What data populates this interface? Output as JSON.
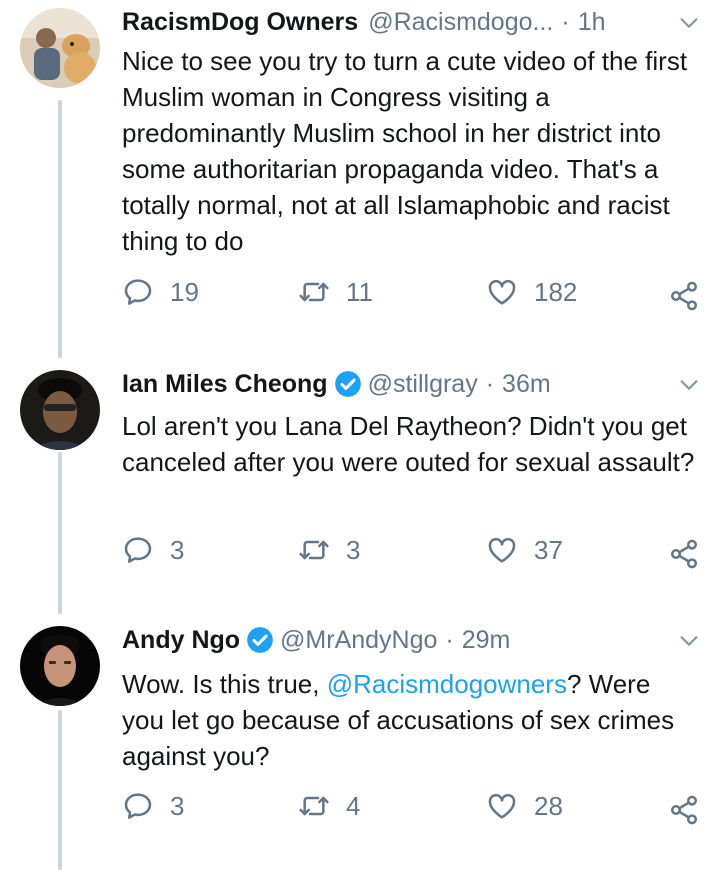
{
  "tweets": [
    {
      "name": "RacismDog Owners",
      "handle": "@Racismdogo...",
      "separator": "·",
      "time": "1h",
      "verified": false,
      "text": "Nice to see you try to turn a cute video of the first Muslim woman in Congress visiting a predominantly Muslim school in her district into some authoritarian propaganda video. That's a totally normal, not at all Islamaphobic and racist thing to do",
      "replies": "19",
      "retweets": "11",
      "likes": "182"
    },
    {
      "name": "Ian Miles Cheong",
      "handle": "@stillgray",
      "separator": "·",
      "time": "36m",
      "verified": true,
      "text": "Lol aren't you Lana Del Raytheon? Didn't you get canceled after you were outed for sexual assault?",
      "replies": "3",
      "retweets": "3",
      "likes": "37"
    },
    {
      "name": "Andy Ngo",
      "handle": "@MrAndyNgo",
      "separator": "·",
      "time": "29m",
      "verified": true,
      "text_before": "Wow. Is this true, ",
      "mention": "@Racismdogowners",
      "text_after": "? Were you let go because of accusations of sex crimes against you?",
      "replies": "3",
      "retweets": "4",
      "likes": "28"
    }
  ],
  "colors": {
    "text": "#14171a",
    "secondary": "#657786",
    "link": "#1da1f2",
    "verified": "#1da1f2",
    "thread_line": "#ccd6dd"
  },
  "icons": [
    "reply-icon",
    "retweet-icon",
    "like-icon",
    "share-icon",
    "chevron-down-icon",
    "verified-badge-icon"
  ]
}
